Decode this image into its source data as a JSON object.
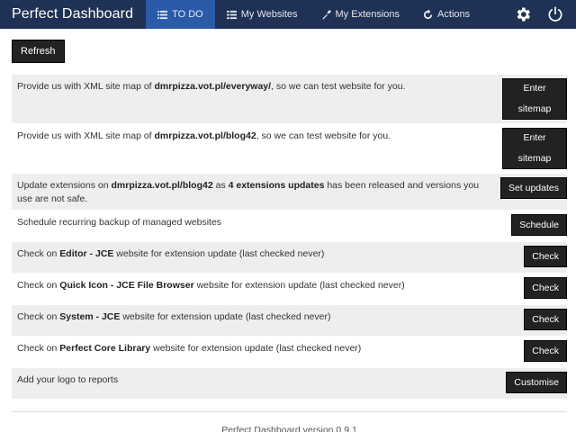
{
  "app": {
    "brand": "Perfect Dashboard"
  },
  "nav": {
    "items": [
      {
        "label": "TO DO",
        "icon": "todo-list-icon",
        "active": true
      },
      {
        "label": "My Websites",
        "icon": "list-icon",
        "active": false
      },
      {
        "label": "My Extensions",
        "icon": "puzzle-icon",
        "active": false
      },
      {
        "label": "Actions",
        "icon": "refresh-icon",
        "active": false
      }
    ],
    "right": [
      {
        "icon": "gear-icon"
      },
      {
        "icon": "power-icon"
      }
    ]
  },
  "toolbar": {
    "refresh_label": "Refresh"
  },
  "tasks": [
    {
      "text_pre": "Provide us with XML site map of ",
      "text_bold": "dmrpizza.vot.pl/everyway/",
      "text_post": ", so we can test website for you.",
      "button": "Enter sitemap"
    },
    {
      "text_pre": "Provide us with XML site map of ",
      "text_bold": "dmrpizza.vot.pl/blog42",
      "text_post": ", so we can test website for you.",
      "button": "Enter sitemap"
    },
    {
      "text_pre": "Update extensions on ",
      "text_bold": "dmrpizza.vot.pl/blog42",
      "text_mid": " as ",
      "text_bold2": "4 extensions updates",
      "text_post": " has been released and versions you use are not safe.",
      "button": "Set updates"
    },
    {
      "text_pre": "Schedule recurring backup of managed websites",
      "button": "Schedule"
    },
    {
      "text_pre": "Check on ",
      "text_bold": "Editor - JCE",
      "text_post": " website for extension update (last checked never)",
      "button": "Check"
    },
    {
      "text_pre": "Check on ",
      "text_bold": "Quick Icon - JCE File Browser",
      "text_post": " website for extension update (last checked never)",
      "button": "Check"
    },
    {
      "text_pre": "Check on ",
      "text_bold": "System - JCE",
      "text_post": " website for extension update (last checked never)",
      "button": "Check"
    },
    {
      "text_pre": "Check on ",
      "text_bold": "Perfect Core Library",
      "text_post": " website for extension update (last checked never)",
      "button": "Check"
    },
    {
      "text_pre": "Add your logo to reports",
      "button": "Customise"
    }
  ],
  "footer": {
    "version_text": "Perfect Dashboard version 0.9.1"
  },
  "colors": {
    "navbar": "#1f3155",
    "active_tab": "#2b5aa8",
    "button": "#222222",
    "row_alt": "#eeeeee"
  }
}
